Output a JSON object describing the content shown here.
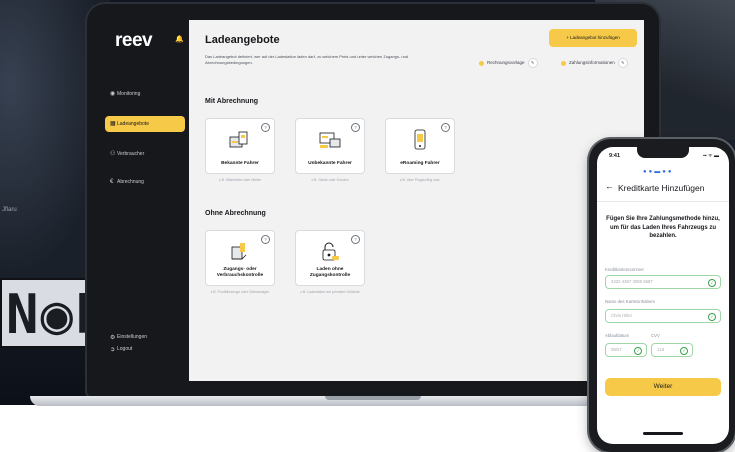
{
  "background": {
    "plate_text": "N◉P",
    "left_text": "Jflaru"
  },
  "app": {
    "logo": "reev",
    "sidebar": {
      "items": [
        {
          "label": "Monitoring",
          "icon": "monitor-icon"
        },
        {
          "label": "Ladeangebote",
          "icon": "charging-offer-icon",
          "active": true
        },
        {
          "label": "Verbraucher",
          "icon": "users-icon"
        },
        {
          "label": "Abrechnung",
          "icon": "euro-icon"
        }
      ],
      "bottom": [
        {
          "label": "Einstellungen",
          "icon": "gear-icon"
        },
        {
          "label": "Logout",
          "icon": "logout-icon"
        }
      ]
    },
    "header": {
      "title": "Ladeangebote",
      "description": "Das Ladeangebot definiert, wer auf der Ladestation laden darf, zu welchem Preis und unter welchen Zugangs- und Abrechnungsbedingungen.",
      "add_button": "+ Ladeangebot hinzufügen",
      "pills": [
        "Rechnungsvorlage",
        "Zahlungsinformationen"
      ]
    },
    "sections": {
      "mit": "Mit Abrechnung",
      "ohne": "Ohne Abrechnung"
    },
    "cards_mit": [
      {
        "label": "Bekannte Fahrer",
        "caption": "z.B. Mitarbeiter oder Mieter"
      },
      {
        "label": "Unbekannte Fahrer",
        "caption": "z.B. Gäste oder Kunden"
      },
      {
        "label": "eRoaming Fahrer",
        "caption": "z.B. über Plugsurfing usw."
      }
    ],
    "cards_ohne": [
      {
        "label": "Zugangs- oder Verbrauchskontrolle",
        "caption": "z.B. Poolfahrzeuge oder Dienstwagen"
      },
      {
        "label": "Laden ohne Zugangskontrolle",
        "caption": "z.B. Ladestation auf privatem Gelände"
      }
    ]
  },
  "phone": {
    "time": "9:41",
    "status": "▪▪ ᯤ ▬",
    "back": "←",
    "title": "Kreditkarte Hinzufügen",
    "intro": "Fügen Sie Ihre Zahlungsmethode hinzu, um für das Laden Ihres Fahrzeugs zu bezahlen.",
    "fields": {
      "card_label": "Kreditkartennummer",
      "card_value": "4322 4367 3088 5687",
      "name_label": "Name des Karteninhabers",
      "name_value": "Chris Hiller",
      "expiry_label": "Ablaufdatum",
      "expiry_value": "09/27",
      "cvv_label": "CVV",
      "cvv_value": "123"
    },
    "button": "Weiter"
  },
  "colors": {
    "accent": "#f7c948",
    "sidebar": "#16181c",
    "success": "#37a24a"
  }
}
